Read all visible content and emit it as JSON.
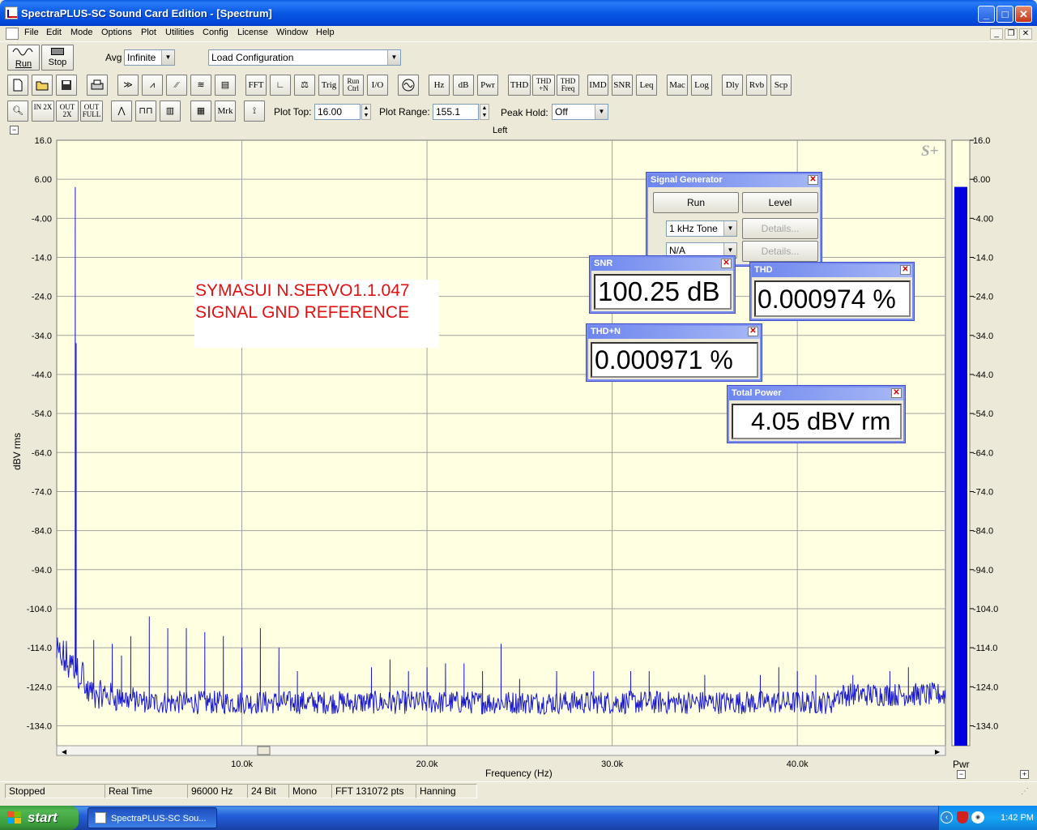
{
  "window": {
    "title": "SpectraPLUS-SC Sound Card Edition - [Spectrum]"
  },
  "menu": [
    "File",
    "Edit",
    "Mode",
    "Options",
    "Plot",
    "Utilities",
    "Config",
    "License",
    "Window",
    "Help"
  ],
  "toolbar1": {
    "run_label": "Run",
    "stop_label": "Stop",
    "avg_label": "Avg",
    "avg_value": "Infinite",
    "config_value": "Load Configuration"
  },
  "toolbar2": [
    "FFT",
    "Trig",
    "Run Ctrl",
    "I/O",
    "Hz",
    "dB",
    "Pwr",
    "THD",
    "THD +N",
    "THD Freq",
    "IMD",
    "SNR",
    "Leq",
    "Mac",
    "Log",
    "Dly",
    "Rvb",
    "Scp"
  ],
  "toolbar3": {
    "zoom": [
      "IN 2X",
      "OUT 2X",
      "OUT FULL"
    ],
    "mrk": "Mrk",
    "plot_top_label": "Plot Top:",
    "plot_top_value": "16.00",
    "plot_range_label": "Plot Range:",
    "plot_range_value": "155.1",
    "peak_hold_label": "Peak Hold:",
    "peak_hold_value": "Off"
  },
  "graph": {
    "channel": "Left",
    "ylabel": "dBV rms",
    "xlabel": "Frequency (Hz)",
    "logo": "S+",
    "bar_label": "Pwr",
    "annotation_line1": "SYMASUI N.SERVO1.1.047",
    "annotation_line2": "SIGNAL GND REFERENCE"
  },
  "chart_data": {
    "type": "line",
    "xlabel": "Frequency (Hz)",
    "ylabel": "dBV rms",
    "ylim": [
      -139.1,
      16.0
    ],
    "xlim": [
      0,
      48000
    ],
    "y_ticks": [
      "16.0",
      "6.00",
      "-4.00",
      "-14.0",
      "-24.0",
      "-34.0",
      "-44.0",
      "-54.0",
      "-64.0",
      "-74.0",
      "-84.0",
      "-94.0",
      "-104.0",
      "-114.0",
      "-124.0",
      "-134.0"
    ],
    "x_ticks": [
      "10.0k",
      "20.0k",
      "30.0k",
      "40.0k"
    ],
    "grid": true,
    "series": [
      {
        "color": "#1a1acc",
        "noise_floor": -128,
        "peaks": [
          {
            "x": 1000,
            "y": 4.0
          },
          {
            "x": 1050,
            "y": -36.0
          },
          {
            "x": 2000,
            "y": -112.0
          },
          {
            "x": 3000,
            "y": -113.0
          },
          {
            "x": 3500,
            "y": -116.0
          },
          {
            "x": 4000,
            "y": -111.0
          },
          {
            "x": 5000,
            "y": -106.0
          },
          {
            "x": 6000,
            "y": -109.0
          },
          {
            "x": 7000,
            "y": -109.0
          },
          {
            "x": 8000,
            "y": -110.0
          },
          {
            "x": 9000,
            "y": -111.0
          },
          {
            "x": 10000,
            "y": -114.0
          },
          {
            "x": 11000,
            "y": -109.0
          },
          {
            "x": 12000,
            "y": -114.0
          },
          {
            "x": 13000,
            "y": -120.0
          },
          {
            "x": 17000,
            "y": -119.0
          },
          {
            "x": 18000,
            "y": -117.0
          },
          {
            "x": 19000,
            "y": -120.0
          },
          {
            "x": 20000,
            "y": -119.0
          },
          {
            "x": 21000,
            "y": -118.0
          },
          {
            "x": 22000,
            "y": -118.0
          },
          {
            "x": 23000,
            "y": -120.0
          },
          {
            "x": 24000,
            "y": -113.0
          },
          {
            "x": 25000,
            "y": -122.0
          },
          {
            "x": 27000,
            "y": -120.0
          },
          {
            "x": 29000,
            "y": -120.0
          },
          {
            "x": 31000,
            "y": -120.0
          },
          {
            "x": 32000,
            "y": -120.0
          },
          {
            "x": 35000,
            "y": -121.0
          },
          {
            "x": 38000,
            "y": -121.0
          },
          {
            "x": 39000,
            "y": -119.0
          },
          {
            "x": 40000,
            "y": -120.0
          },
          {
            "x": 41000,
            "y": -121.0
          },
          {
            "x": 43000,
            "y": -121.0
          },
          {
            "x": 45000,
            "y": -120.0
          },
          {
            "x": 46000,
            "y": -119.0
          }
        ]
      }
    ],
    "power_bar": {
      "value": 4.05
    }
  },
  "signal_generator": {
    "title": "Signal Generator",
    "run": "Run",
    "level": "Level",
    "waveform": "1 kHz Tone",
    "details1": "Details...",
    "second": "N/A",
    "details2": "Details..."
  },
  "readouts": {
    "snr": {
      "title": "SNR",
      "value": "100.25 dB"
    },
    "thd": {
      "title": "THD",
      "value": "0.000974 %"
    },
    "thdn": {
      "title": "THD+N",
      "value": "0.000971 %"
    },
    "power": {
      "title": "Total Power",
      "value": "4.05 dBV rm"
    }
  },
  "status": [
    "Stopped",
    "Real Time",
    "96000 Hz",
    "24 Bit",
    "Mono",
    "FFT 131072 pts",
    "Hanning"
  ],
  "taskbar": {
    "start": "start",
    "task": "SpectraPLUS-SC Sou...",
    "clock": "1:42 PM"
  }
}
